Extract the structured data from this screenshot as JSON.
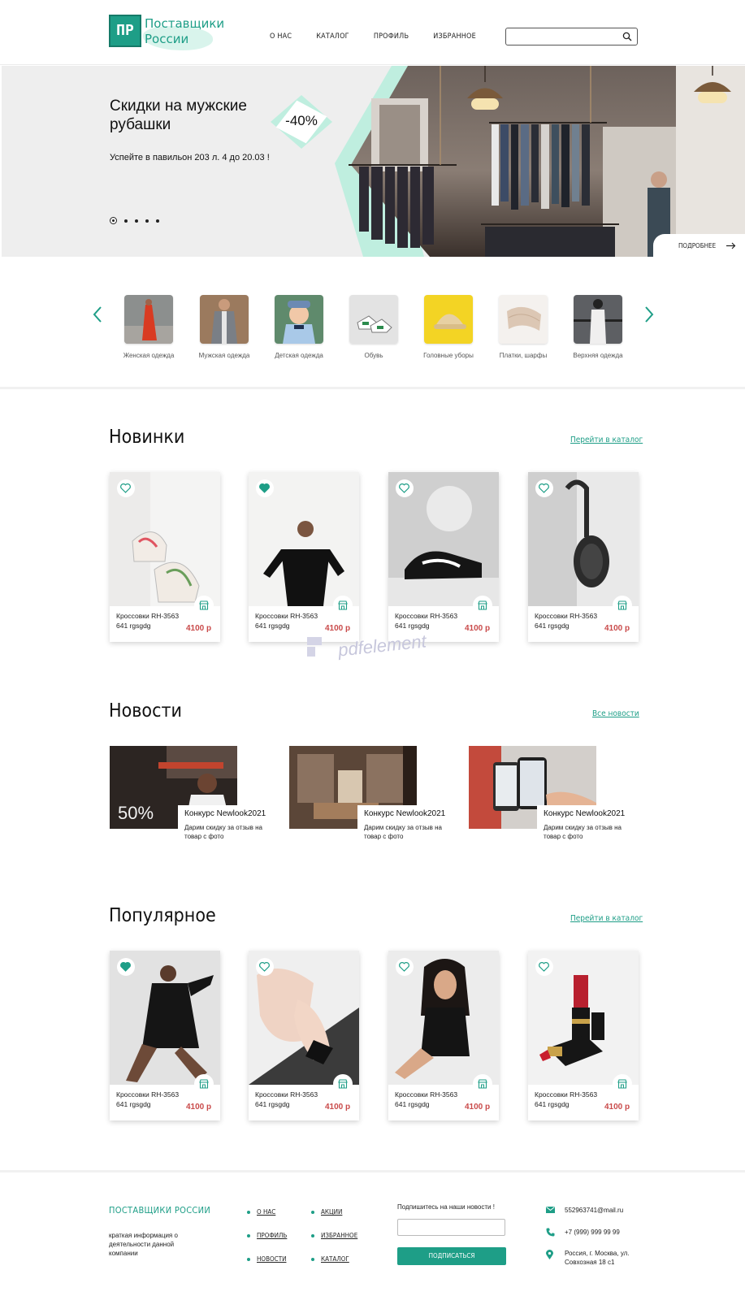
{
  "brand": {
    "logo_mark": "ПР",
    "logo_line1": "Поставщики",
    "logo_line2": "России"
  },
  "nav": {
    "about": "О НАС",
    "catalog": "КАТАЛОГ",
    "profile": "ПРОФИЛЬ",
    "favorites": "ИЗБРАННОЕ"
  },
  "search": {
    "placeholder": ""
  },
  "hero": {
    "title": "Скидки на мужские рубашки",
    "subtitle": "Успейте  в павильон 203 л. 4 до 20.03 !",
    "discount": "-40%",
    "more_label": "ПОДРОБНЕЕ",
    "slides_total": 5,
    "active_slide": 1
  },
  "categories": [
    {
      "label": "Женская одежда"
    },
    {
      "label": "Мужская одежда"
    },
    {
      "label": "Детская одежда"
    },
    {
      "label": "Обувь"
    },
    {
      "label": "Головные уборы"
    },
    {
      "label": "Платки, шарфы"
    },
    {
      "label": "Верхняя одежда"
    }
  ],
  "new_section": {
    "title": "Новинки",
    "link": "Перейти в каталог",
    "products": [
      {
        "name": "Кроссовки RH-3563 641 rgsgdg",
        "price": "4100 р",
        "favorite": false
      },
      {
        "name": "Кроссовки RH-3563 641 rgsgdg",
        "price": "4100 р",
        "favorite": true
      },
      {
        "name": "Кроссовки RH-3563 641 rgsgdg",
        "price": "4100 р",
        "favorite": false
      },
      {
        "name": "Кроссовки RH-3563 641 rgsgdg",
        "price": "4100 р",
        "favorite": false
      }
    ]
  },
  "news_section": {
    "title": "Новости",
    "link": "Все новости",
    "items": [
      {
        "title": "Конкурс  Newlook2021",
        "text": "Дарим скидку за отзыв на товар с фото",
        "image_text": "50%"
      },
      {
        "title": "Конкурс  Newlook2021",
        "text": "Дарим скидку за отзыв на товар с фото"
      },
      {
        "title": "Конкурс  Newlook2021",
        "text": "Дарим скидку за отзыв на товар с фото"
      }
    ]
  },
  "popular_section": {
    "title": "Популярное",
    "link": "Перейти в каталог",
    "products": [
      {
        "name": "Кроссовки RH-3563 641 rgsgdg",
        "price": "4100 р",
        "favorite": true
      },
      {
        "name": "Кроссовки RH-3563 641 rgsgdg",
        "price": "4100 р",
        "favorite": false
      },
      {
        "name": "Кроссовки RH-3563 641 rgsgdg",
        "price": "4100 р",
        "favorite": false
      },
      {
        "name": "Кроссовки RH-3563 641 rgsgdg",
        "price": "4100 р",
        "favorite": false
      }
    ]
  },
  "footer": {
    "brand": "ПОСТАВЩИКИ РОССИИ",
    "about": "краткая информация о деятельности данной компании",
    "links_col1": [
      "О НАС",
      "ПРОФИЛЬ",
      "НОВОСТИ"
    ],
    "links_col2": [
      "АКЦИИ",
      "ИЗБРАННОЕ",
      "КАТАЛОГ"
    ],
    "subscribe_label": "Подпишитесь на наши новости !",
    "subscribe_button": "ПОДПИСАТЬСЯ",
    "email": "552963741@mail.ru",
    "phone": "+7 (999) 999 99 99",
    "address": "Россия, г. Москва, ул. Совхозная 18 с1"
  },
  "watermark": "pdfelement",
  "colors": {
    "accent": "#1e9e87",
    "price": "#c94a4a",
    "mint": "#bfeedf"
  },
  "icons": [
    "search-icon",
    "arrow-right-icon",
    "chevron-left-icon",
    "chevron-right-icon",
    "heart-icon",
    "store-icon",
    "mail-icon",
    "phone-icon",
    "location-pin-icon"
  ]
}
